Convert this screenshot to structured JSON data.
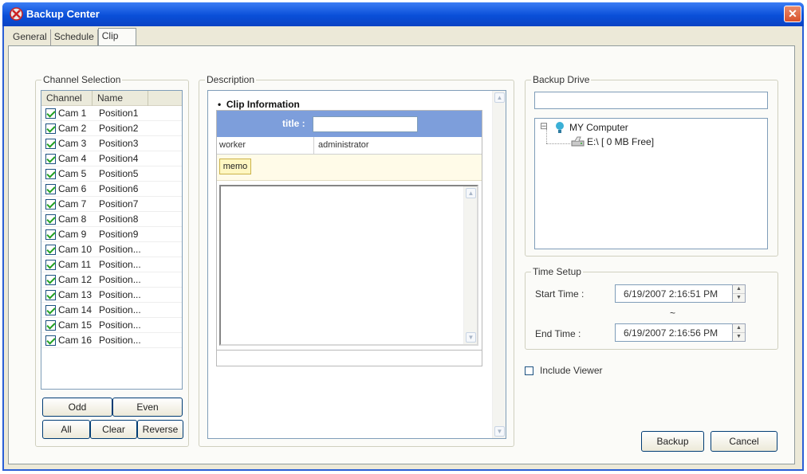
{
  "window": {
    "title": "Backup Center",
    "close_glyph": "✕"
  },
  "tabs": [
    {
      "label": "General"
    },
    {
      "label": "Schedule"
    },
    {
      "label": "Clip",
      "active": true
    }
  ],
  "channel_selection": {
    "label": "Channel Selection",
    "columns": [
      "Channel",
      "Name"
    ],
    "rows": [
      {
        "channel": "Cam 1",
        "name": "Position1",
        "checked": true
      },
      {
        "channel": "Cam 2",
        "name": "Position2",
        "checked": true
      },
      {
        "channel": "Cam 3",
        "name": "Position3",
        "checked": true
      },
      {
        "channel": "Cam 4",
        "name": "Position4",
        "checked": true
      },
      {
        "channel": "Cam 5",
        "name": "Position5",
        "checked": true
      },
      {
        "channel": "Cam 6",
        "name": "Position6",
        "checked": true
      },
      {
        "channel": "Cam 7",
        "name": "Position7",
        "checked": true
      },
      {
        "channel": "Cam 8",
        "name": "Position8",
        "checked": true
      },
      {
        "channel": "Cam 9",
        "name": "Position9",
        "checked": true
      },
      {
        "channel": "Cam 10",
        "name": "Position...",
        "checked": true
      },
      {
        "channel": "Cam 11",
        "name": "Position...",
        "checked": true
      },
      {
        "channel": "Cam 12",
        "name": "Position...",
        "checked": true
      },
      {
        "channel": "Cam 13",
        "name": "Position...",
        "checked": true
      },
      {
        "channel": "Cam 14",
        "name": "Position...",
        "checked": true
      },
      {
        "channel": "Cam 15",
        "name": "Position...",
        "checked": true
      },
      {
        "channel": "Cam 16",
        "name": "Position...",
        "checked": true
      }
    ],
    "buttons": {
      "odd": "Odd",
      "even": "Even",
      "all": "All",
      "clear": "Clear",
      "reverse": "Reverse"
    }
  },
  "description": {
    "label": "Description",
    "clip_heading": "Clip Information",
    "title_label": "title :",
    "title_value": "",
    "worker_label": "worker",
    "worker_value": "administrator",
    "memo_label": "memo",
    "memo_value": ""
  },
  "backup_drive": {
    "label": "Backup Drive",
    "path_value": "",
    "tree": {
      "root": "MY Computer",
      "expander": "⊟",
      "child": "E:\\ [ 0 MB Free]"
    }
  },
  "time_setup": {
    "label": "Time Setup",
    "start_label": "Start Time :",
    "start_value": "6/19/2007  2:16:51 PM",
    "separator": "~",
    "end_label": "End Time :",
    "end_value": "6/19/2007  2:16:56 PM"
  },
  "include_viewer": {
    "label": "Include Viewer",
    "checked": false
  },
  "actions": {
    "backup": "Backup",
    "cancel": "Cancel"
  }
}
